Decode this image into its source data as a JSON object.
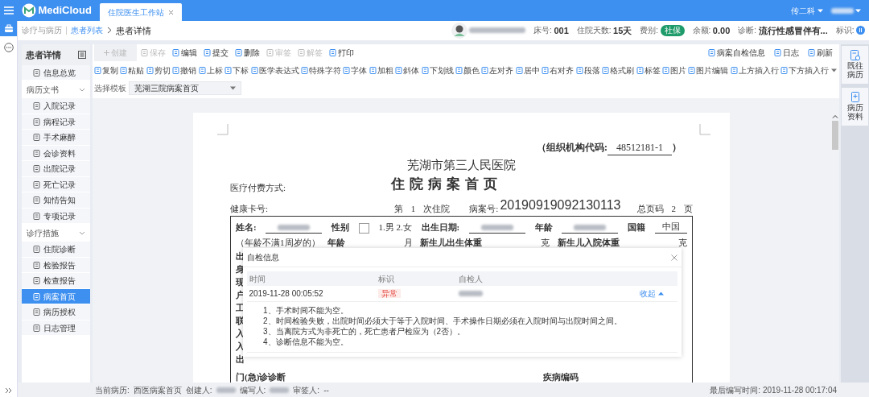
{
  "top_bar": {
    "brand": "MediCloud",
    "tabs": [
      {
        "label": "住院医生工作站",
        "selected": true
      }
    ],
    "department": "传二科",
    "user_redacted": true
  },
  "breadcrumb": [
    {
      "label": "诊疗与病历",
      "kind": "plain"
    },
    {
      "label": "患者列表",
      "kind": "link"
    },
    {
      "label": "患者详情",
      "kind": "current"
    }
  ],
  "patient": {
    "name_redacted": true,
    "fields": [
      {
        "label": "床号:",
        "value": "001",
        "kind": "text"
      },
      {
        "label": "住院天数:",
        "value": "15天",
        "kind": "text"
      },
      {
        "label": "费别:",
        "value": "社保",
        "kind": "badge"
      },
      {
        "label": "余额:",
        "value": "0.00",
        "kind": "text"
      },
      {
        "label": "诊断:",
        "value": "流行性感冒伴有...",
        "kind": "text"
      },
      {
        "label": "标识:",
        "kind": "dot"
      }
    ]
  },
  "sidebar": {
    "title": "患者详情",
    "items": [
      {
        "label": "信息总览",
        "selected": false
      },
      {
        "label": "病历文书",
        "expanded": true,
        "children": [
          {
            "label": "入院记录",
            "selected": false
          },
          {
            "label": "病程记录",
            "selected": false
          },
          {
            "label": "手术麻醉",
            "selected": false
          },
          {
            "label": "会诊资料",
            "selected": false
          },
          {
            "label": "出院记录",
            "selected": false
          },
          {
            "label": "死亡记录",
            "selected": false
          },
          {
            "label": "知情告知",
            "selected": false
          },
          {
            "label": "专项记录",
            "selected": false
          }
        ]
      },
      {
        "label": "诊疗措施",
        "expanded": true,
        "children": [
          {
            "label": "住院诊断",
            "selected": false
          },
          {
            "label": "检验报告",
            "selected": false
          },
          {
            "label": "检查报告",
            "selected": false
          },
          {
            "label": "病案首页",
            "selected": true
          },
          {
            "label": "病历授权",
            "selected": false
          },
          {
            "label": "日志管理",
            "selected": false
          }
        ]
      }
    ]
  },
  "toolbar": {
    "actions": [
      {
        "label": "创建",
        "kind": "primary",
        "disabled": true
      },
      {
        "label": "保存",
        "kind": "plain",
        "disabled": true
      },
      {
        "label": "编辑",
        "kind": "plain",
        "disabled": false
      },
      {
        "label": "提交",
        "kind": "plain",
        "disabled": false
      },
      {
        "label": "删除",
        "kind": "plain",
        "disabled": false
      },
      {
        "label": "审签",
        "kind": "plain",
        "disabled": true
      },
      {
        "label": "解签",
        "kind": "plain",
        "disabled": true
      },
      {
        "label": "打印",
        "kind": "plain",
        "disabled": false
      }
    ],
    "right_actions": [
      {
        "label": "病案自检信息"
      },
      {
        "label": "日志"
      },
      {
        "label": "刷新"
      }
    ]
  },
  "format_toolbar": [
    "复制",
    "粘贴",
    "剪切",
    "撤销",
    "上标",
    "下标",
    "医学表达式",
    "特殊字符",
    "字体",
    "加粗",
    "斜体",
    "下划线",
    "颜色",
    "左对齐",
    "居中",
    "右对齐",
    "段落",
    "格式刷",
    "标签",
    "图片",
    "图片编辑",
    "上方插入行",
    "下方插入行"
  ],
  "template": {
    "label": "选择模板",
    "value": "芜湖三院病案首页"
  },
  "document": {
    "org_code": {
      "label": "（组织机构代码:",
      "value": "48512181-1",
      "close": "）"
    },
    "hospital": "芜湖市第三人民医院",
    "title": "住 院 病 案 首 页",
    "payment_label": "医疗付费方式:",
    "info_row": [
      {
        "text": "健康卡号:",
        "kind": "plain"
      },
      {
        "text": "第",
        "kind": "plain"
      },
      {
        "text": "1",
        "kind": "plain"
      },
      {
        "text": "次住院",
        "kind": "plain"
      },
      {
        "text": "病案号:",
        "kind": "plain"
      },
      {
        "text": "20190919092130113",
        "kind": "big"
      },
      {
        "text": "总页码",
        "kind": "plain"
      },
      {
        "text": "2",
        "kind": "plain"
      },
      {
        "text": "页",
        "kind": "plain"
      }
    ],
    "form_lines": [
      {
        "segments": [
          {
            "kind": "label",
            "text": "姓名:"
          },
          {
            "kind": "blurred"
          },
          {
            "kind": "label",
            "text": "性别"
          },
          {
            "kind": "checkbox"
          },
          {
            "kind": "note",
            "text": "1.男 2.女"
          },
          {
            "kind": "label",
            "text": "出生日期:"
          },
          {
            "kind": "blurred"
          },
          {
            "kind": "label",
            "text": "年龄"
          },
          {
            "kind": "blurred"
          },
          {
            "kind": "label",
            "text": "国籍"
          },
          {
            "kind": "value",
            "text": "中国"
          }
        ]
      },
      {
        "segments": [
          {
            "kind": "note",
            "text": "（年龄不满1周岁的）"
          },
          {
            "kind": "label",
            "text": "年龄"
          },
          {
            "kind": "blank"
          },
          {
            "kind": "note",
            "text": "月"
          },
          {
            "kind": "label",
            "text": "新生儿出生体重"
          },
          {
            "kind": "blank"
          },
          {
            "kind": "note",
            "text": "克"
          },
          {
            "kind": "label",
            "text": "新生儿入院体重"
          },
          {
            "kind": "blank"
          },
          {
            "kind": "note",
            "text": "克"
          }
        ]
      }
    ],
    "side_labels": [
      "出",
      "身",
      "现",
      "户",
      "工",
      "联",
      "入",
      "入",
      "出"
    ],
    "last_row": [
      {
        "kind": "label",
        "text": "门(急)诊诊断"
      },
      {
        "kind": "longblank"
      },
      {
        "kind": "label",
        "text": "疾病编码"
      },
      {
        "kind": "blank"
      }
    ]
  },
  "dialog": {
    "title": "自检信息",
    "columns": [
      "时间",
      "标识",
      "自检人"
    ],
    "rows": [
      {
        "time": "2019-11-28 00:05:52",
        "flag": "异常",
        "checker_redacted": true,
        "toggle": "收起",
        "expanded": true,
        "messages": [
          "1、手术时间不能为空。",
          "2、时间检验失败，出院时间必须大于等于入院时间、手术操作日期必须在入院时间与出院时间之间。",
          "3、当离院方式为非死亡的，死亡患者尸检应为（2否）。",
          "4、诊断信息不能为空。"
        ]
      }
    ]
  },
  "right_panel": [
    "既往病历",
    "病历资料"
  ],
  "status_bar": {
    "items": [
      {
        "label": "当前病历:",
        "value": "西医病案首页"
      },
      {
        "label": "创建人:",
        "redacted": true
      },
      {
        "label": "编写人:",
        "redacted": true
      },
      {
        "label": "审签人:",
        "value": "--"
      }
    ],
    "last_edit": {
      "label": "最后编写时间:",
      "value": "2019-11-28 00:17:04"
    }
  }
}
